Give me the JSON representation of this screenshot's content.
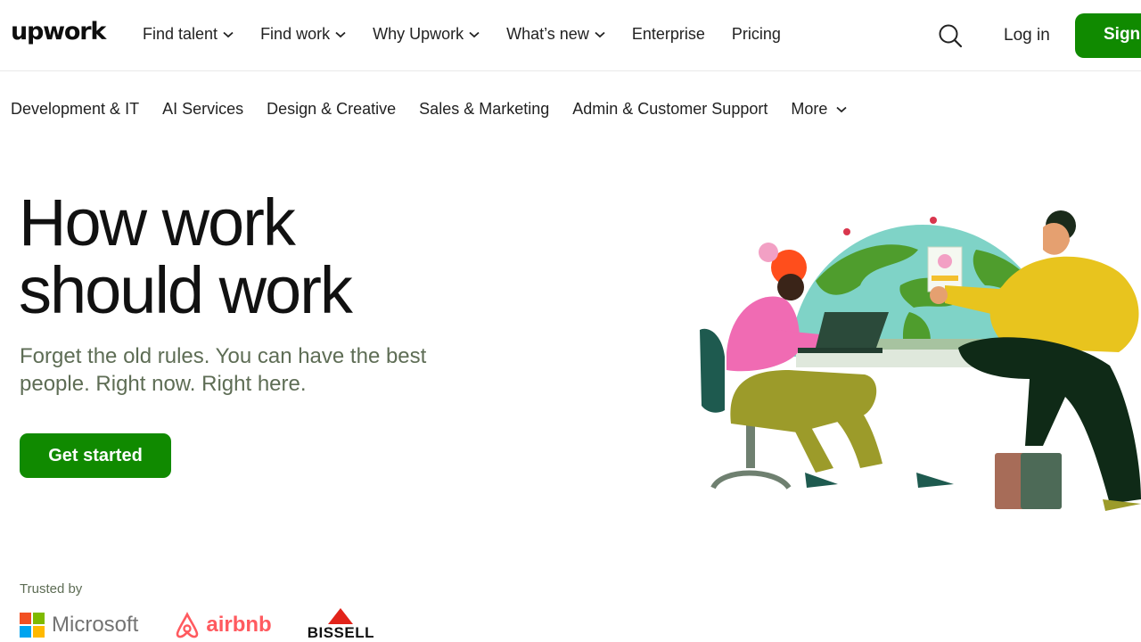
{
  "header": {
    "logo": "upwork",
    "nav": [
      {
        "label": "Find talent",
        "has_menu": true
      },
      {
        "label": "Find work",
        "has_menu": true
      },
      {
        "label": "Why Upwork",
        "has_menu": true
      },
      {
        "label": "What’s new",
        "has_menu": true
      },
      {
        "label": "Enterprise",
        "has_menu": false
      },
      {
        "label": "Pricing",
        "has_menu": false
      }
    ],
    "search_icon": "search-icon",
    "login": "Log in",
    "signup": "Sign up"
  },
  "categories": {
    "items": [
      "Development & IT",
      "AI Services",
      "Design & Creative",
      "Sales & Marketing",
      "Admin & Customer Support"
    ],
    "more": "More"
  },
  "hero": {
    "title_line1": "How work",
    "title_line2": "should work",
    "subtitle": "Forget the old rules. You can have the best people. Right now. Right here.",
    "cta": "Get started"
  },
  "trusted": {
    "label": "Trusted by",
    "logos": [
      "Microsoft",
      "airbnb",
      "BISSELL"
    ]
  },
  "colors": {
    "brand_green": "#108a00",
    "text": "#181818",
    "muted_text": "#5e6d55"
  }
}
